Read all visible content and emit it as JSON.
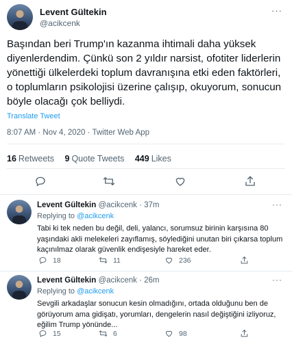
{
  "tweet": {
    "author_name": "Levent Gültekin",
    "author_handle": "@acikcenk",
    "more_label": "···",
    "text": "Başından beri Trump'ın kazanma ihtimali daha yüksek diyenlerdendim. Çünkü son 2 yıldır narsist, ofotiter liderlerin yönettiği ülkelerdeki toplum davranışına etki eden faktörleri, o toplumların psikolojisi üzerine çalışıp, okuyorum, sonucun böyle olacağı çok belliydi.",
    "translate_label": "Translate Tweet",
    "timestamp": "8:07 AM · Nov 4, 2020 · Twitter Web App",
    "retweets_count": "16",
    "retweets_label": "Retweets",
    "quotes_count": "9",
    "quotes_label": "Quote Tweets",
    "likes_count": "449",
    "likes_label": "Likes",
    "icons": [
      "reply-icon",
      "retweet-icon",
      "like-icon",
      "share-icon"
    ]
  },
  "replies": [
    {
      "author_name": "Levent Gültekin",
      "meta": "@acikcenk · 37m",
      "replying_prefix": "Replying to",
      "replying_to": "@acikcenk",
      "text": "Tabi ki tek neden bu değil, deli, yalancı, sorumsuz birinin karşısına 80 yaşındaki akli melekeleri zayıflamış, söylediğini unutan biri çıkarsa toplum kaçınılmaz olarak güvenlik endişesiyle hareket eder.",
      "reply_count": "18",
      "retweet_count": "11",
      "like_count": "236"
    },
    {
      "author_name": "Levent Gültekin",
      "meta": "@acikcenk · 26m",
      "replying_prefix": "Replying to",
      "replying_to": "@acikcenk",
      "text": "Sevgili arkadaşlar sonucun kesin olmadığını, ortada olduğunu ben de görüyorum ama gidişatı, yorumları, dengelerin nasıl değiştiğini izliyoruz, eğilim Trump yönünde...",
      "reply_count": "15",
      "retweet_count": "6",
      "like_count": "98"
    }
  ],
  "colors": {
    "text": "#0f1419",
    "secondary": "#536471",
    "accent": "#1d9bf0",
    "border": "#e6ecf0"
  }
}
